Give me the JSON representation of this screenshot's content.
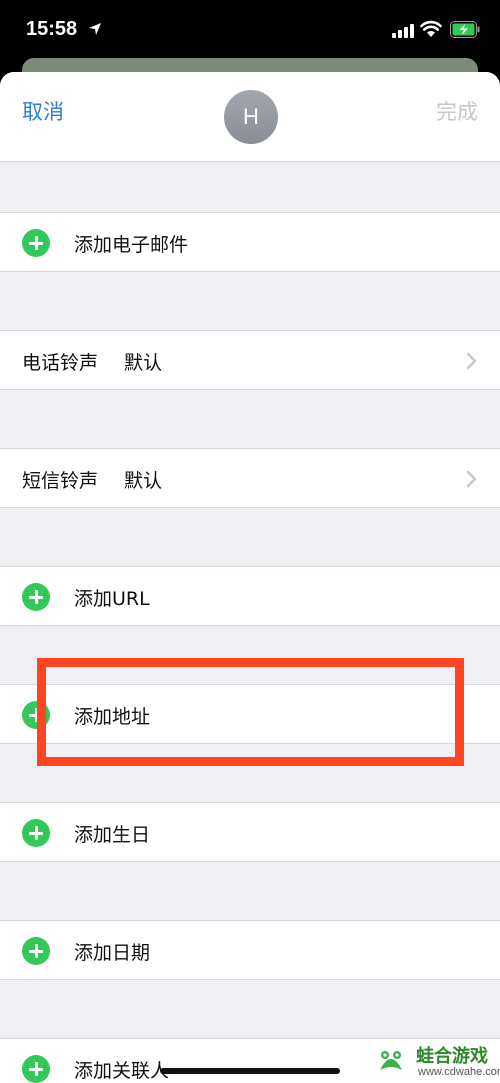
{
  "status_bar": {
    "time": "15:58"
  },
  "nav": {
    "cancel_label": "取消",
    "avatar_initial": "H",
    "done_label": "完成"
  },
  "rows": {
    "add_email": "添加电子邮件",
    "ringtone_title": "电话铃声",
    "ringtone_value": "默认",
    "text_tone_title": "短信铃声",
    "text_tone_value": "默认",
    "add_url": "添加URL",
    "add_address": "添加地址",
    "add_birthday": "添加生日",
    "add_date": "添加日期",
    "add_related": "添加关联人"
  },
  "watermark": {
    "name": "蛙合游戏",
    "url": "www.cdwahe.com"
  },
  "colors": {
    "accent": "#2f7fd1",
    "add_green": "#34c759",
    "highlight": "#ff4422",
    "grouped_bg": "#efeff4"
  }
}
